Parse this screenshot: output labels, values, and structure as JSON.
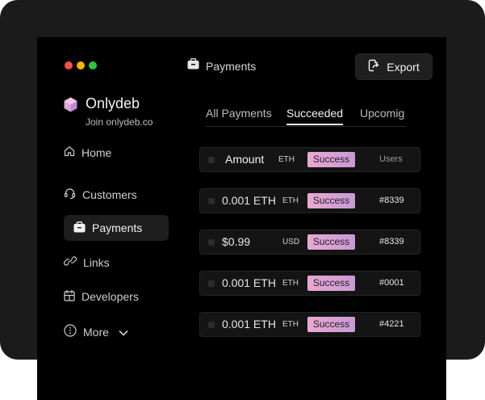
{
  "window": {
    "title": "Payments"
  },
  "toolbar": {
    "export_label": "Export"
  },
  "brand": {
    "name": "Onlydeb",
    "subtitle": "Join onlydeb.co"
  },
  "sidebar": {
    "items": [
      {
        "label": "Home",
        "icon": "home-icon"
      },
      {
        "label": "Customers",
        "icon": "headset-icon"
      },
      {
        "label": "Payments",
        "icon": "briefcase-icon",
        "active": true
      },
      {
        "label": "Links",
        "icon": "link-icon"
      },
      {
        "label": "Developers",
        "icon": "developers-icon"
      },
      {
        "label": "More",
        "icon": "more-icon"
      }
    ]
  },
  "tabs": [
    {
      "label": "All Payments"
    },
    {
      "label": "Succeeded",
      "active": true
    },
    {
      "label": "Upcomig"
    }
  ],
  "table": {
    "header": {
      "amount": "Amount",
      "currency": "ETH",
      "status": "Success",
      "user": "Users"
    },
    "rows": [
      {
        "amount": "0.001 ETH",
        "currency": "ETH",
        "status": "Success",
        "user": "#8339"
      },
      {
        "amount": "$0.99",
        "currency": "USD",
        "status": "Success",
        "user": "#8339"
      },
      {
        "amount": "0.001 ETH",
        "currency": "ETH",
        "status": "Success",
        "user": "#0001"
      },
      {
        "amount": "0.001 ETH",
        "currency": "ETH",
        "status": "Success",
        "user": "#4221"
      }
    ]
  },
  "colors": {
    "background": "#000000",
    "device_frame": "#1b1b1b",
    "status_badge": "#e9a9cf",
    "traffic_red": "#ff4d4d",
    "traffic_yellow": "#f7b500",
    "traffic_green": "#28c840"
  }
}
